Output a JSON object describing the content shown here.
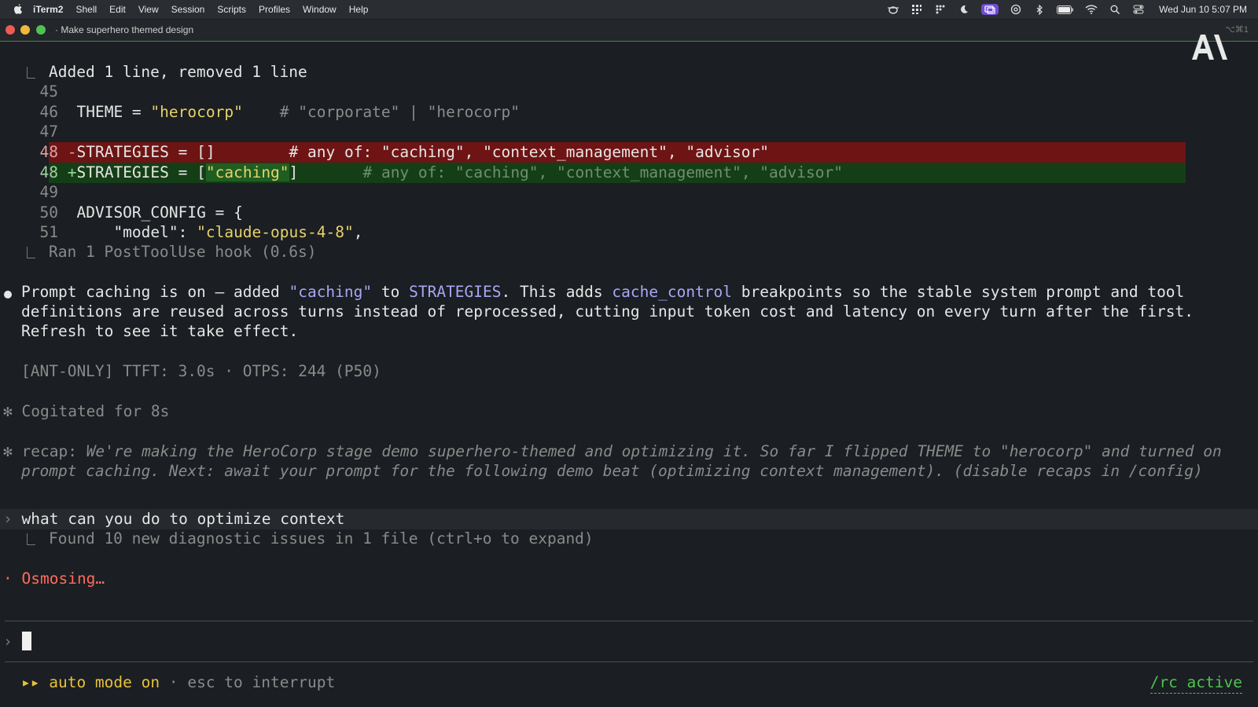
{
  "menubar": {
    "app_name": "iTerm2",
    "items": [
      "Shell",
      "Edit",
      "View",
      "Session",
      "Scripts",
      "Profiles",
      "Window",
      "Help"
    ],
    "clock": "Wed Jun 10  5:07 PM",
    "status_icons": [
      "bug-icon",
      "grid-icon",
      "dots-grid-icon",
      "moon-icon",
      "screen-mirror-icon",
      "at-icon",
      "bluetooth-icon",
      "battery-icon",
      "wifi-icon",
      "search-icon",
      "control-center-icon"
    ]
  },
  "window": {
    "title": "Make superhero themed design",
    "shortcut": "⌥⌘1"
  },
  "edit_result": {
    "summary": "Added 1 line, removed 1 line",
    "lines": [
      {
        "num": "45",
        "text": ""
      },
      {
        "num": "46",
        "code": "THEME = ",
        "str": "\"herocorp\"",
        "comment": "    # \"corporate\" | \"herocorp\""
      },
      {
        "num": "47",
        "text": ""
      },
      {
        "num": "48",
        "sign": "-",
        "code": "STRATEGIES = []",
        "comment": "        # any of: \"caching\", \"context_management\", \"advisor\""
      },
      {
        "num": "48",
        "sign": "+",
        "code_pre": "STRATEGIES = [",
        "code_hl": "\"caching\"",
        "code_post": "]",
        "comment": "       # any of: \"caching\", \"context_management\", \"advisor\""
      },
      {
        "num": "49",
        "text": ""
      },
      {
        "num": "50",
        "code": "ADVISOR_CONFIG = {"
      },
      {
        "num": "51",
        "code": "    \"model\": ",
        "str": "\"claude-opus-4-8\"",
        "tail": ","
      }
    ],
    "hook": "Ran 1 PostToolUse hook (0.6s)"
  },
  "message": {
    "p1_a": "Prompt caching is on — added ",
    "p1_caching": "\"caching\"",
    "p1_b": " to ",
    "p1_strategies": "STRATEGIES",
    "p1_c": ". This adds ",
    "p1_cache_control": "cache_control",
    "p1_d": " breakpoints so the stable system prompt and tool",
    "p2": "definitions are reused across turns instead of reprocessed, cutting input token cost and latency on every turn after the first.",
    "p3": "Refresh to see it take effect."
  },
  "stats": "[ANT-ONLY] TTFT: 3.0s · OTPS: 244 (P50)",
  "cogitated": "Cogitated for 8s",
  "recap": {
    "label": "recap:",
    "line1": " We're making the HeroCorp stage demo superhero-themed and optimizing it. So far I flipped THEME to \"herocorp\" and turned on",
    "line2": "prompt caching. Next: await your prompt for the following demo beat (optimizing context management). (disable recaps in /config)"
  },
  "user_prompt": "what can you do to optimize context",
  "diagnostics": "Found 10 new diagnostic issues in 1 file (ctrl+o to expand)",
  "status_spinner": "Osmosing…",
  "footer": {
    "arrows": "▸▸",
    "mode": "auto mode on",
    "hint": " · esc to interrupt",
    "rc": "/rc active"
  },
  "colors": {
    "background": "#1b1e22",
    "diff_removed": "#6e1414",
    "diff_added": "#143f16",
    "string": "#e6d36b",
    "accent_purple": "#a9a6f5",
    "spinner": "#ff6b5c",
    "auto_mode": "#e6c13a",
    "rc_active": "#4fc252"
  }
}
